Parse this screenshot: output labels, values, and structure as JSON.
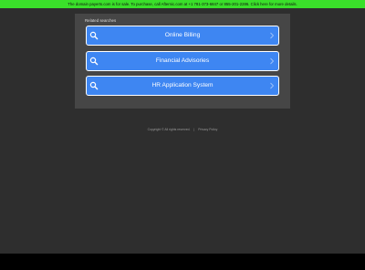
{
  "banner": {
    "text": "The domain payerts.com is for sale. To purchase, call Afternic.com at +1 781-373-6847 or 855-201-2286. Click here for more details."
  },
  "related": {
    "title": "Related searches",
    "items": [
      {
        "label": "Online Billing",
        "icon": "search-icon"
      },
      {
        "label": "Financial Advisories",
        "icon": "search-icon"
      },
      {
        "label": "HR Application System",
        "icon": "search-icon"
      }
    ]
  },
  "footer": {
    "copyright": "Copyright © All rights reserved.",
    "separator": "|",
    "privacy": "Privacy Policy"
  },
  "colors": {
    "banner": "#3ae02a",
    "background": "#2e2e2e",
    "panel": "#464646",
    "button": "#3e86f2"
  }
}
